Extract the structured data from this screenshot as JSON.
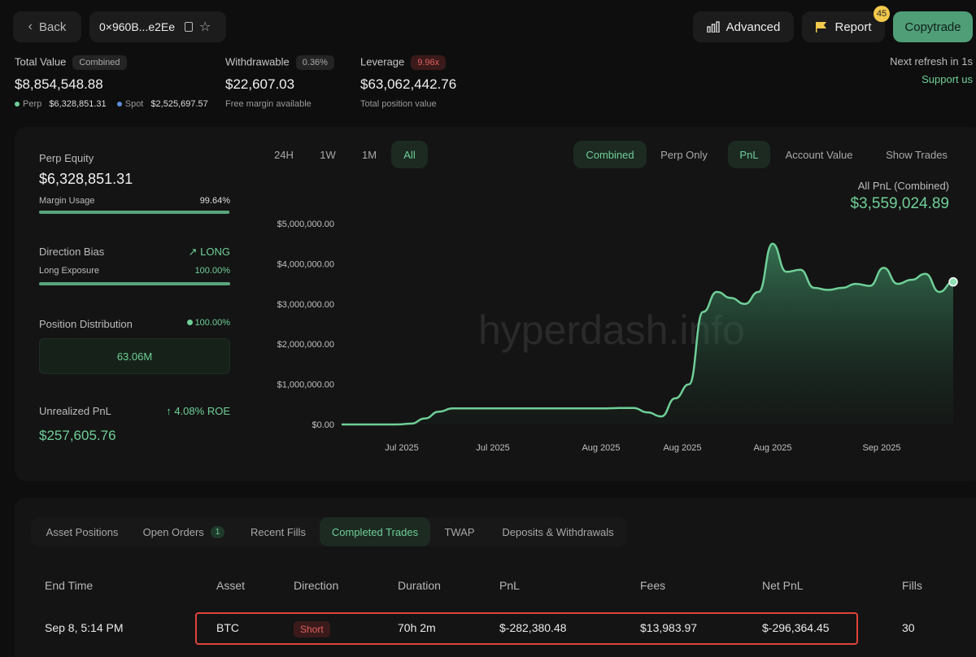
{
  "header": {
    "back_label": "Back",
    "address": "0×960B...e2Ee",
    "advanced_label": "Advanced",
    "report_label": "Report",
    "report_badge": "45",
    "copytrade_label": "Copytrade",
    "next_refresh": "Next refresh in 1s",
    "support_link": "Support us"
  },
  "stats": {
    "total_value": {
      "label": "Total Value",
      "tag": "Combined",
      "value": "$8,854,548.88",
      "perp_label": "Perp",
      "perp_value": "$6,328,851.31",
      "spot_label": "Spot",
      "spot_value": "$2,525,697.57"
    },
    "withdrawable": {
      "label": "Withdrawable",
      "tag": "0.36%",
      "value": "$22,607.03",
      "sub": "Free margin available"
    },
    "leverage": {
      "label": "Leverage",
      "tag": "9.96x",
      "value": "$63,062,442.76",
      "sub": "Total position value"
    }
  },
  "left_panel": {
    "perp_equity_label": "Perp Equity",
    "perp_equity_value": "$6,328,851.31",
    "margin_usage_label": "Margin Usage",
    "margin_usage_value": "99.64%",
    "margin_usage_fraction": 0.9964,
    "direction_bias_label": "Direction Bias",
    "direction_bias_value": "LONG",
    "long_exposure_label": "Long Exposure",
    "long_exposure_value": "100.00%",
    "long_exposure_fraction": 1.0,
    "position_distribution_label": "Position Distribution",
    "position_distribution_pct": "100.00%",
    "position_distribution_value": "63.06M",
    "unrealized_pnl_label": "Unrealized PnL",
    "roe_value": "4.08% ROE",
    "unrealized_pnl_value": "$257,605.76"
  },
  "chart_controls": {
    "ranges": [
      "24H",
      "1W",
      "1M",
      "All"
    ],
    "active_range": "All",
    "views": [
      "Combined",
      "Perp Only"
    ],
    "active_view": "Combined",
    "metrics": [
      "PnL",
      "Account Value"
    ],
    "active_metric": "PnL",
    "show_trades_label": "Show Trades",
    "summary_label": "All PnL (Combined)",
    "summary_value": "$3,559,024.89",
    "watermark": "hyperdash.info"
  },
  "chart_data": {
    "type": "area",
    "y_ticks": [
      "$5,000,000.00",
      "$4,000,000.00",
      "$3,000,000.00",
      "$2,000,000.00",
      "$1,000,000.00",
      "$0.00"
    ],
    "x_ticks": [
      "Jul 2025",
      "Jul 2025",
      "Aug 2025",
      "Aug 2025",
      "Aug 2025",
      "Sep 2025"
    ],
    "ylim": [
      0,
      5000000
    ],
    "series": [
      {
        "values": [
          0,
          0,
          0,
          0,
          0,
          20000,
          150000,
          320000,
          400000,
          400000,
          400000,
          400000,
          400000,
          400000,
          400000,
          400000,
          400000,
          400000,
          400000,
          400000,
          410000,
          410000,
          300000,
          200000,
          650000,
          1000000,
          2800000,
          3300000,
          3150000,
          3000000,
          3300000,
          4500000,
          3800000,
          3850000,
          3400000,
          3350000,
          3400000,
          3500000,
          3450000,
          3900000,
          3500000,
          3600000,
          3750000,
          3300000,
          3550000
        ]
      }
    ],
    "color": "#6fcf97"
  },
  "tabs": {
    "items": [
      "Asset Positions",
      "Open Orders",
      "Recent Fills",
      "Completed Trades",
      "TWAP",
      "Deposits & Withdrawals"
    ],
    "open_orders_count": "1",
    "active": "Completed Trades"
  },
  "table": {
    "headers": [
      "End Time",
      "Asset",
      "Direction",
      "Duration",
      "PnL",
      "Fees",
      "Net PnL",
      "Fills"
    ],
    "row": {
      "end_time": "Sep 8, 5:14 PM",
      "asset": "BTC",
      "direction": "Short",
      "duration": "70h 2m",
      "pnl": "$-282,380.48",
      "fees": "$13,983.97",
      "net_pnl": "$-296,364.45",
      "fills": "30"
    }
  }
}
